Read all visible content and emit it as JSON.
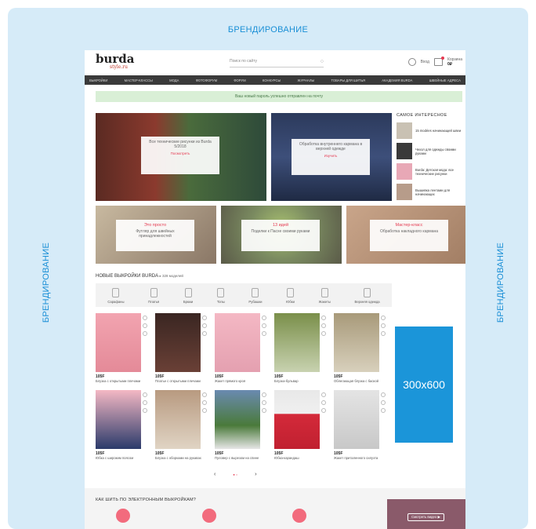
{
  "branding": {
    "top": "БРЕНДИРОВАНИЕ",
    "left": "БРЕНДИРОВАНИЕ",
    "right": "БРЕНДИРОВАНИЕ"
  },
  "ad": {
    "label": "300x600"
  },
  "header": {
    "logo_main": "burda",
    "logo_sub": "style.ru",
    "search_placeholder": "Поиск по сайту",
    "login_label": "Вход",
    "cart_label": "Корзина",
    "cart_value": "0₽"
  },
  "nav": [
    "ВЫКРОЙКИ",
    "МАСТЕР-КЛАССЫ",
    "МОДА",
    "ФОТОФОРУМ",
    "ФОРУМ",
    "КОНКУРСЫ",
    "ЖУРНАЛЫ",
    "ТОВАРЫ ДЛЯ ШИТЬЯ",
    "АКАДЕМИЯ BURDA",
    "ШВЕЙНЫЕ АДРЕСА"
  ],
  "alert": "Ваш новый пароль успешно отправлен на почту",
  "heroes": [
    {
      "title": "",
      "text": "Все технические рисунки из Burda 5/2018",
      "cta": "Посмотреть"
    },
    {
      "title": "",
      "text": "Обработка внутреннего кармана в верхней одежде",
      "cta": "Изучить"
    },
    {
      "title": "Это просто",
      "text": "Футляр для швейных принадлежностей",
      "cta": ""
    },
    {
      "title": "13 идей",
      "text": "Поделки к Пасхе своими руками",
      "cta": ""
    },
    {
      "title": "Мастер-класс",
      "text": "Обработка накладного кармана",
      "cta": ""
    }
  ],
  "sidebar": {
    "title": "САМОЕ ИНТЕРЕСНОЕ",
    "items": [
      "15 modées начинающей швеи",
      "Чехол для одежды своими руками",
      "Burda: Детская мода: все технические рисунки",
      "Вышивка лентами для начинающих"
    ]
  },
  "products_section": {
    "title": "НОВЫЕ ВЫКРОЙКИ BURDA",
    "count": "▸ 328 моделей"
  },
  "categories": [
    "Сарафаны",
    "Платья",
    "Брюки",
    "Топы",
    "Рубашки",
    "Юбки",
    "Жакеты",
    "Верхняя одежда"
  ],
  "products": [
    {
      "code": "105F",
      "name": "Блузка с открытыми плечами"
    },
    {
      "code": "105F",
      "name": "Платье с открытыми плечами"
    },
    {
      "code": "105F",
      "name": "Жакет прямого кроя"
    },
    {
      "code": "105F",
      "name": "Блузка-бульвар"
    },
    {
      "code": "105F",
      "name": "Облегающая блузка с баской"
    },
    {
      "code": "105F",
      "name": "Юбка с широким поясом"
    },
    {
      "code": "105F",
      "name": "Блузка с оборками на рукавах"
    },
    {
      "code": "105F",
      "name": "Пуловер с вырезом на спине"
    },
    {
      "code": "105F",
      "name": "Юбка-карандаш"
    },
    {
      "code": "105F",
      "name": "Жакет приталенного силуэта"
    }
  ],
  "pager": {
    "prev": "‹",
    "next": "›",
    "dots": "● ○"
  },
  "how_to": {
    "title": "КАК ШИТЬ ПО ЭЛЕКТРОННЫМ ВЫКРОЙКАМ?",
    "video_button": "Смотреть видео ▶"
  },
  "colors": {
    "branding_bg": "#d6ebf8",
    "branding_text": "#1a8fd6",
    "ad_bg": "#1b95d9",
    "accent": "#e53950",
    "nav_bg": "#3a3a3a",
    "alert_bg": "#d9efd6"
  }
}
